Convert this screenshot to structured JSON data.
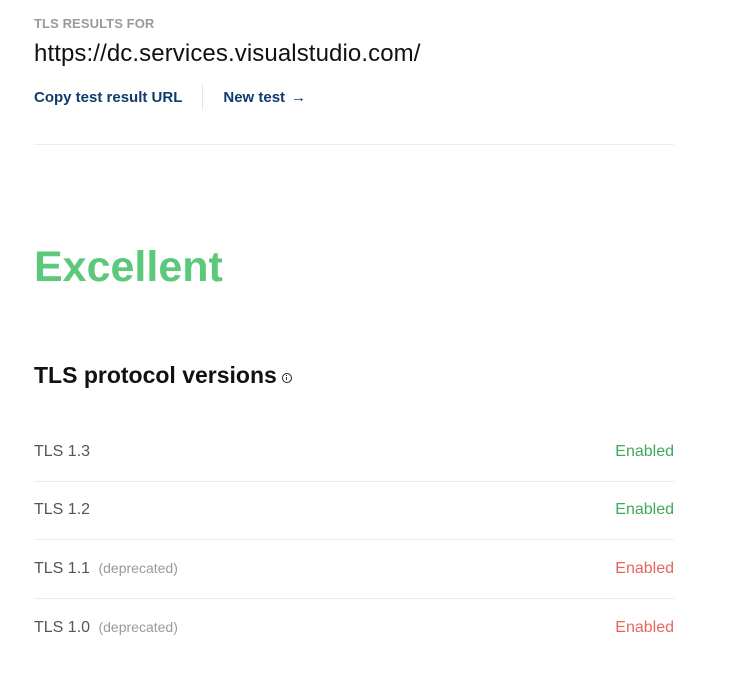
{
  "header": {
    "eyebrow": "TLS RESULTS FOR",
    "url": "https://dc.services.visualstudio.com/"
  },
  "actions": {
    "copy_label": "Copy test result URL",
    "new_test_label": "New test",
    "new_test_arrow": "→"
  },
  "result": {
    "grade": "Excellent",
    "grade_color": "#5cc87a"
  },
  "protocols": {
    "title": "TLS protocol versions",
    "info_icon": "info-icon",
    "rows": [
      {
        "label": "TLS 1.3",
        "note": "",
        "status": "Enabled",
        "status_color": "#3fa85a"
      },
      {
        "label": "TLS 1.2",
        "note": "",
        "status": "Enabled",
        "status_color": "#3fa85a"
      },
      {
        "label": "TLS 1.1",
        "note": "(deprecated)",
        "status": "Enabled",
        "status_color": "#e8655c"
      },
      {
        "label": "TLS 1.0",
        "note": "(deprecated)",
        "status": "Enabled",
        "status_color": "#e8655c"
      }
    ]
  }
}
